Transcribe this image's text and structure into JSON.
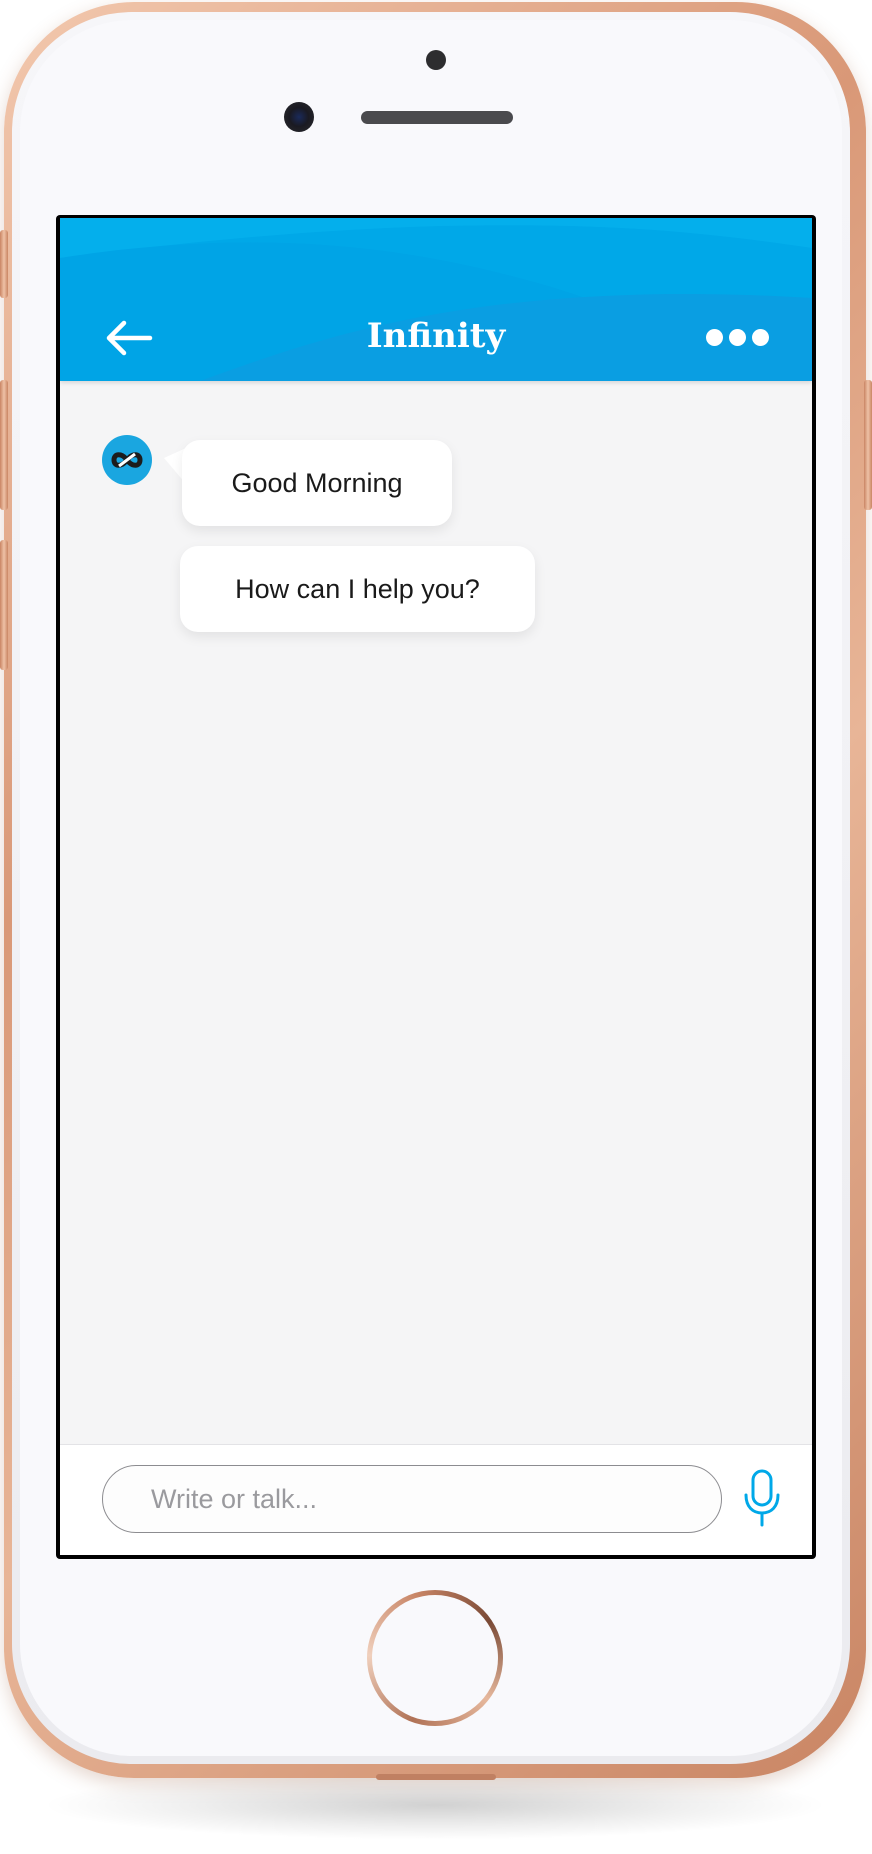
{
  "header": {
    "title": "Infinity",
    "back_icon": "arrow-left-icon",
    "more_icon": "more-horizontal-icon",
    "background_color": "#00a8e8"
  },
  "chat": {
    "bot_avatar_icon": "infinity-logo-icon",
    "messages": [
      {
        "sender": "bot",
        "text": "Good Morning"
      },
      {
        "sender": "bot",
        "text": "How can I help you?"
      }
    ]
  },
  "composer": {
    "placeholder": "Write or talk...",
    "mic_icon": "microphone-icon",
    "accent_color": "#00a8e8"
  }
}
